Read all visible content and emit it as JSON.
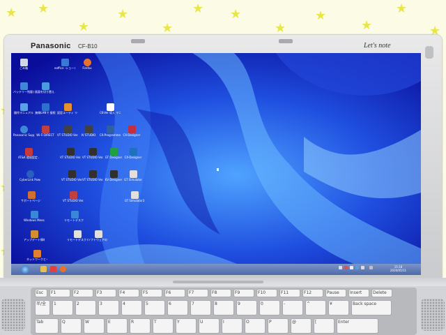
{
  "laptop": {
    "brand": "Panasonic",
    "model": "CF-B10",
    "series_logo": "Let's note"
  },
  "desktop": {
    "icons": [
      {
        "label": "ごみ箱",
        "icon": "recycle-bin-icon",
        "color": "#d0d8e8"
      },
      {
        "label": "eoffice -ショート\nカット",
        "icon": "eoffice-icon",
        "color": "#3a77d8"
      },
      {
        "label": "Firefox",
        "icon": "firefox-icon",
        "color": "#e8722a"
      },
      {
        "label": "バッテリー残量と\n表示",
        "icon": "battery-icon",
        "color": "#3e86d6"
      },
      {
        "label": "画面を切り替え\nる",
        "icon": "display-icon",
        "color": "#4a9be0"
      },
      {
        "label": "操作マニュアル",
        "icon": "manual-icon",
        "color": "#5aa0e8"
      },
      {
        "label": "無線LANで\n接続",
        "icon": "wlan-icon",
        "color": "#2f6fd0"
      },
      {
        "label": "設定ユーティ\nリティ",
        "icon": "settings-icon",
        "color": "#e89030"
      },
      {
        "label": "CK-Ver 導入\nマニュアル",
        "icon": "doc-icon",
        "color": "#ffffff"
      },
      {
        "label": "Panasonic\nSupport",
        "icon": "support-icon",
        "color": "#3e86d6"
      },
      {
        "label": "Wi-Fi DIRECT",
        "icon": "wifi-direct-icon",
        "color": "#c04040"
      },
      {
        "label": "VT STUDIO\nVer.X",
        "icon": "vtstudio-icon",
        "color": "#404040"
      },
      {
        "label": "IV STUDIO",
        "icon": "ivstudio-icon",
        "color": "#404040"
      },
      {
        "label": "CX-Programmer",
        "icon": "cxprog-icon",
        "color": "#3060a0"
      },
      {
        "label": "CX-Designer",
        "icon": "cxdesigner-icon",
        "color": "#c03040"
      },
      {
        "label": "AT&K 環境設定\nバックアップ",
        "icon": "backup-icon",
        "color": "#c83838"
      },
      {
        "label": "VT STUDIO\nVer.3",
        "icon": "vtstudio3-icon",
        "color": "#303030"
      },
      {
        "label": "VT STUDIO\nVer.7",
        "icon": "vtstudio7-icon",
        "color": "#303030"
      },
      {
        "label": "GT Designer",
        "icon": "gtdesigner-icon",
        "color": "#20a040"
      },
      {
        "label": "CX-Designer",
        "icon": "cxdesigner2-icon",
        "color": "#2070c0"
      },
      {
        "label": "CyberLink\nPowerDVD",
        "icon": "powerdvd-icon",
        "color": "#2a5fc0"
      },
      {
        "label": "VT STUDIO\nVer.5",
        "icon": "vtstudio5-icon",
        "color": "#303030"
      },
      {
        "label": "VT STUDIO\nVer.6",
        "icon": "vtstudio6-icon",
        "color": "#303030"
      },
      {
        "label": "KV Designer",
        "icon": "kvdesigner-icon",
        "color": "#303030"
      },
      {
        "label": "GT\nSimulator",
        "icon": "gtsim-icon",
        "color": "#e0e0e0"
      },
      {
        "label": "サポートページ\nアップ",
        "icon": "support-page-icon",
        "color": "#d07030"
      },
      {
        "label": "VT STUDIO\nVer.4",
        "icon": "vtstudio4-icon",
        "color": "#c04040"
      },
      {
        "label": "GT\nSimulator3",
        "icon": "gtsim3-icon",
        "color": "#e0e0e0"
      },
      {
        "label": "Windows\nMessage Center",
        "icon": "message-center-icon",
        "color": "#3a86d8"
      },
      {
        "label": "リモートデスク\nトップ",
        "icon": "remote-desktop-icon",
        "color": "#3a86d8"
      },
      {
        "label": "アップデート情報\nバックアップ",
        "icon": "update-backup-icon",
        "color": "#d09030"
      },
      {
        "label": "リモートデスクトップ\n接続",
        "icon": "rdp-icon",
        "color": "#e0e0e0"
      },
      {
        "label": "ソフトウェアの\nアップデート",
        "icon": "software-update-icon",
        "color": "#e0e0e0"
      },
      {
        "label": "ネットワークとイン\nターネット",
        "icon": "network-icon",
        "color": "#e08030"
      }
    ]
  },
  "taskbar": {
    "clock_time": "15:18",
    "clock_date": "2020/05/11"
  },
  "colors": {
    "desktop_blue": "#0d0fb8",
    "taskbar": "#5f7fbf",
    "lid_silver": "#d9dadc"
  },
  "keyboard": {
    "row0": [
      "Esc",
      "F1",
      "F2",
      "F3",
      "F4",
      "F5",
      "F6",
      "F7",
      "F8",
      "F9",
      "F10",
      "F11",
      "F12",
      "Pause",
      "Insert",
      "Delete"
    ],
    "row1": [
      "半/全",
      "1",
      "2",
      "3",
      "4",
      "5",
      "6",
      "7",
      "8",
      "9",
      "0",
      "-",
      "^",
      "¥",
      "Back space"
    ],
    "row2": [
      "Tab",
      "Q",
      "W",
      "E",
      "R",
      "T",
      "Y",
      "U",
      "I",
      "O",
      "P",
      "@",
      "[",
      "Enter"
    ]
  }
}
